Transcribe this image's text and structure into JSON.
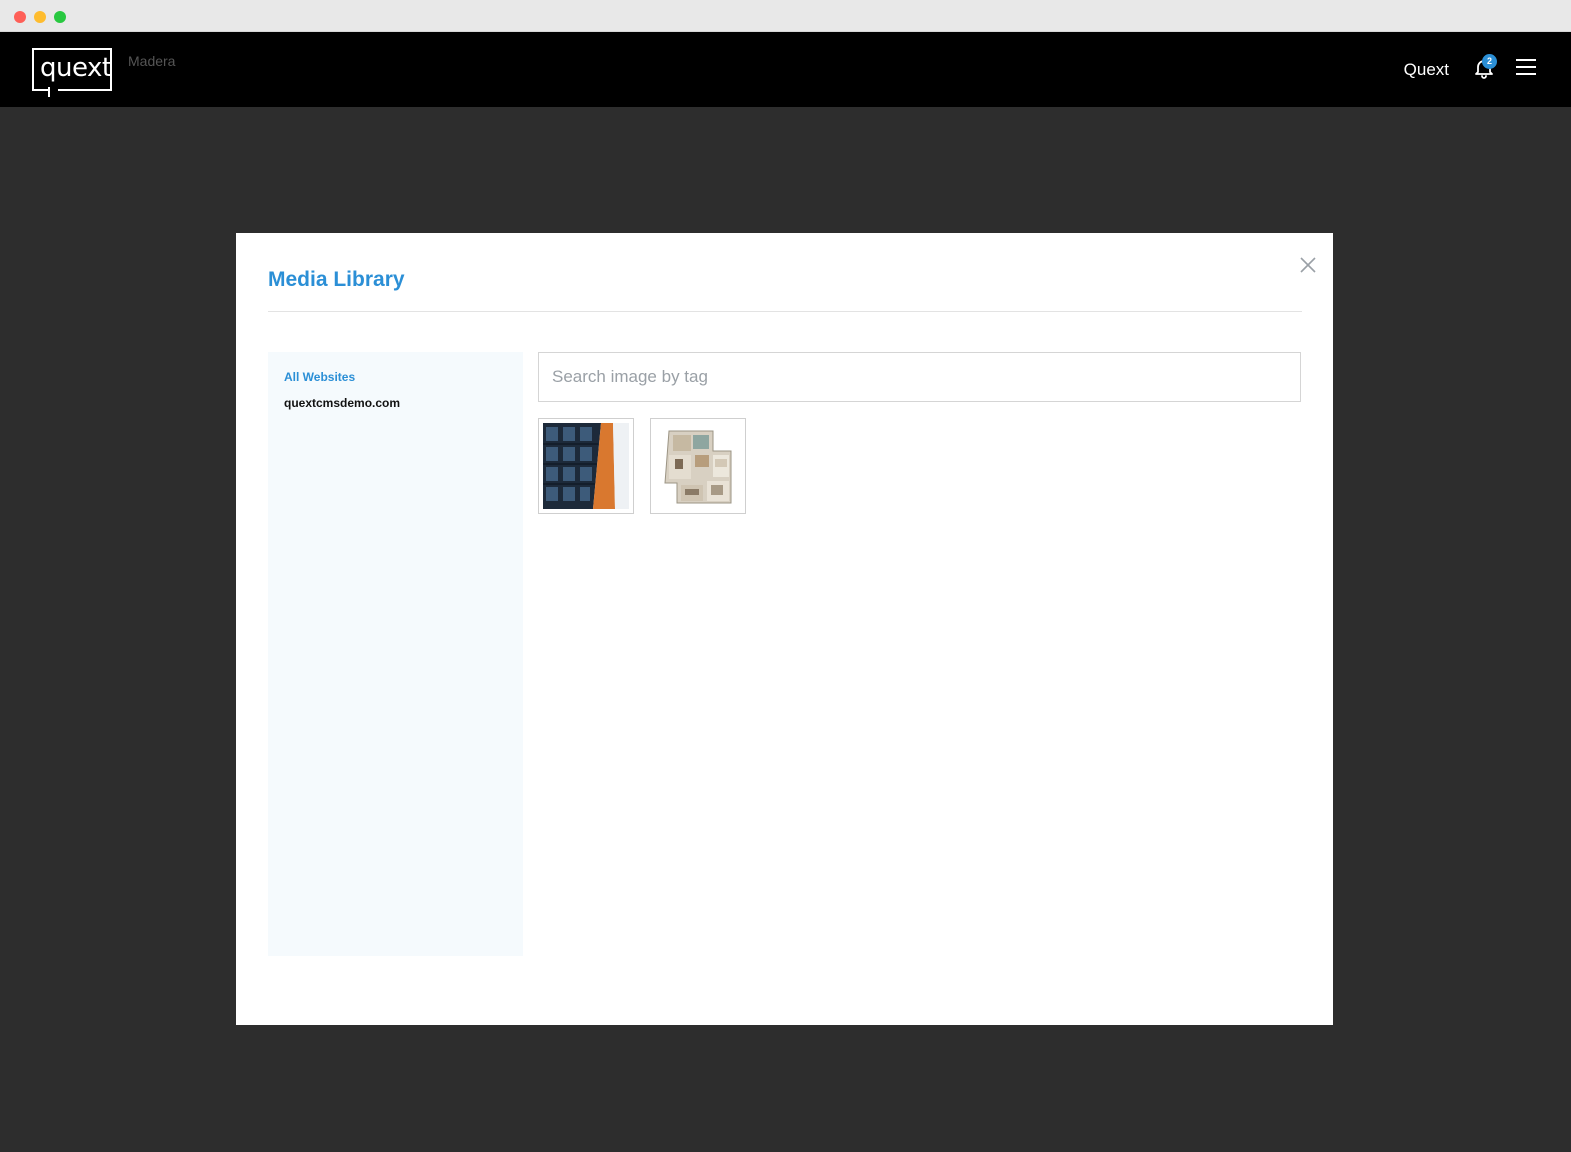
{
  "app": {
    "logo_text": "quext",
    "property_name": "Madera",
    "user_name": "Quext",
    "notification_count": "2"
  },
  "modal": {
    "title": "Media Library",
    "sidebar": {
      "items": [
        {
          "label": "All Websites",
          "active": true
        },
        {
          "label": "quextcmsdemo.com",
          "active": false
        }
      ]
    },
    "search": {
      "placeholder": "Search image by tag",
      "value": ""
    },
    "images": [
      {
        "icon": "building-facade-thumbnail"
      },
      {
        "icon": "floor-plan-thumbnail"
      }
    ]
  },
  "colors": {
    "accent": "#2b8fd6",
    "topbar": "#000000",
    "backdrop": "#2d2d2d",
    "sidebar_bg": "#f5fafd"
  }
}
